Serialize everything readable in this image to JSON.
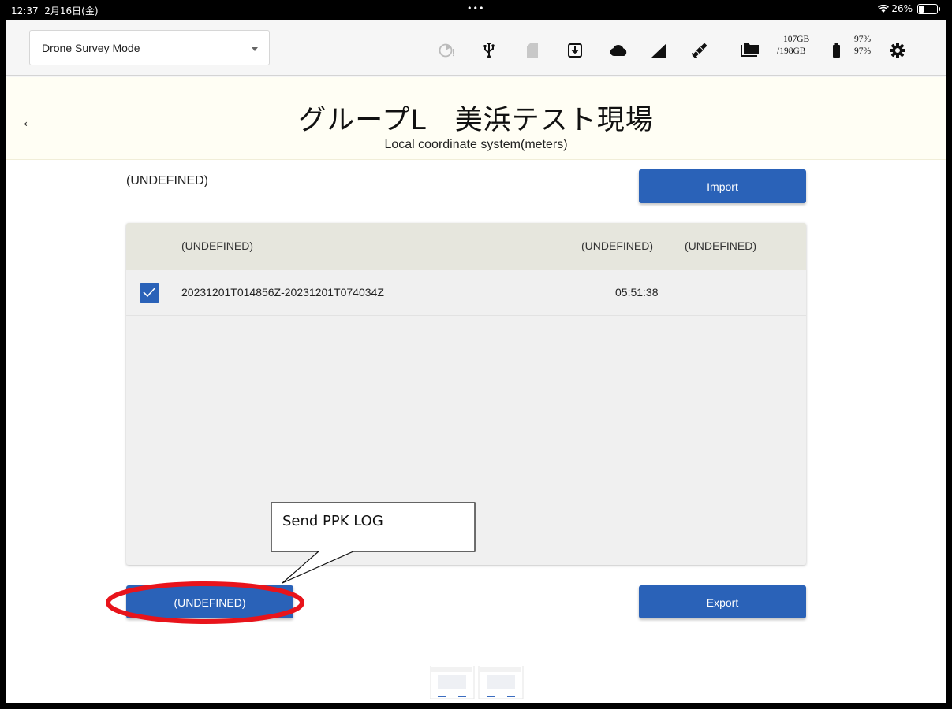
{
  "status_bar": {
    "time": "12:37",
    "date": "2月16日(金)",
    "dots": "•••",
    "battery_percent": "26%"
  },
  "toolbar": {
    "mode_value": "Drone Survey Mode",
    "storage_used": "107GB",
    "storage_total": "/198GB",
    "battery_top": "97%",
    "battery_bottom": "97%",
    "icons": [
      "timer-icon",
      "usb-icon",
      "sd-card-icon",
      "download-icon",
      "cloud-icon",
      "signal-icon",
      "satellite-icon",
      "folder-icon",
      "battery-icon",
      "gear-icon"
    ]
  },
  "header": {
    "back": "←",
    "title": "グループL　美浜テスト現場",
    "subtitle": "Local coordinate system(meters)"
  },
  "main": {
    "section_label": "(UNDEFINED)",
    "import_label": "Import",
    "export_label": "Export",
    "undefined_button_label": "(UNDEFINED)",
    "table": {
      "headers": [
        "(UNDEFINED)",
        "(UNDEFINED)",
        "(UNDEFINED)"
      ],
      "rows": [
        {
          "checked": true,
          "name": "20231201T014856Z-20231201T074034Z",
          "duration": "05:51:38",
          "extra": ""
        }
      ]
    }
  },
  "annotation": {
    "callout_text": "Send PPK LOG",
    "highlight_color": "#e8141b"
  },
  "colors": {
    "accent": "#2a62b8",
    "header_bg": "#fffef4",
    "table_header_bg": "#e6e6dd"
  }
}
